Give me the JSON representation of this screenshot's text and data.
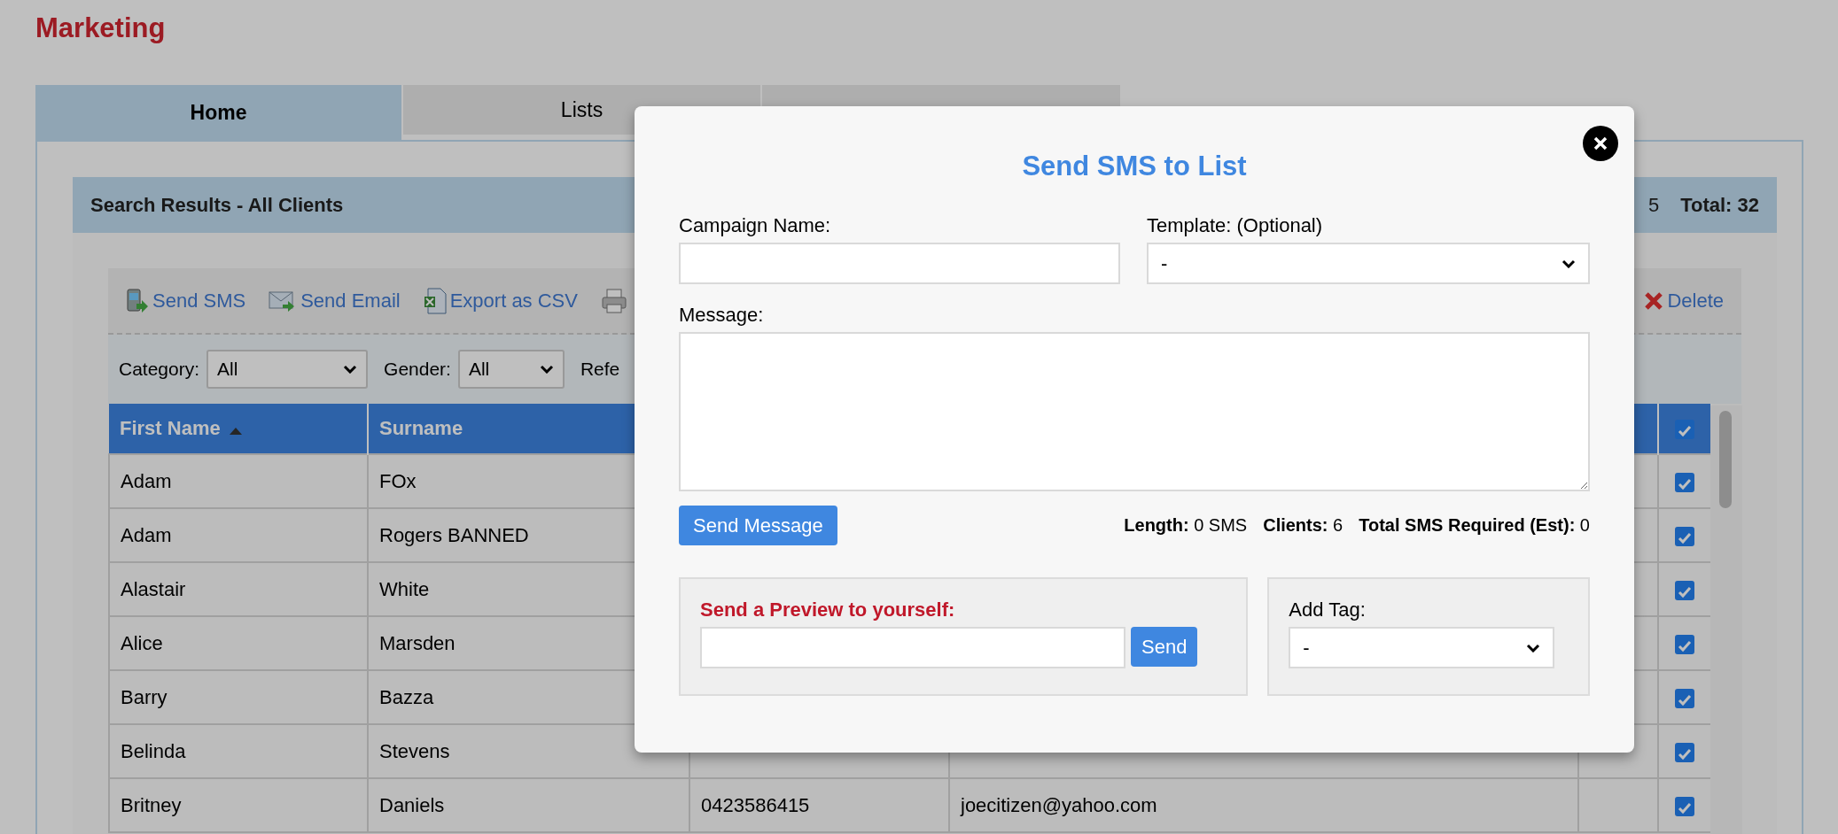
{
  "page_title": "Marketing",
  "tabs": [
    {
      "label": "Home",
      "selected": true
    },
    {
      "label": "Lists",
      "selected": false
    },
    {
      "selected": false
    }
  ],
  "results": {
    "title": "Search Results - All Clients",
    "count_tail": "5",
    "total": "Total: 32"
  },
  "toolbar": [
    {
      "kind": "sms",
      "label": "Send SMS"
    },
    {
      "kind": "email",
      "label": "Send Email"
    },
    {
      "kind": "csv",
      "label": "Export as CSV"
    },
    {
      "kind": "print"
    }
  ],
  "delete": "Delete",
  "filters": [
    {
      "label": "Category:",
      "value": "All"
    },
    {
      "label": "Gender:",
      "value": "All"
    }
  ],
  "filter_tail": "Refe",
  "table": {
    "columns": [
      {
        "label": "First Name",
        "sorted": true
      },
      {
        "label": "Surname",
        "sorted": false
      }
    ],
    "all_checked": true,
    "rows": [
      {
        "first": "Adam",
        "surname": "FOx",
        "checked": true
      },
      {
        "first": "Adam",
        "surname": "Rogers BANNED",
        "checked": true
      },
      {
        "first": "Alastair",
        "surname": "White",
        "checked": true
      },
      {
        "first": "Alice",
        "surname": "Marsden",
        "checked": true
      },
      {
        "first": "Barry",
        "surname": "Bazza",
        "checked": true
      },
      {
        "first": "Belinda",
        "surname": "Stevens",
        "checked": true
      },
      {
        "first": "Britney",
        "surname": "Daniels",
        "phone": "0423586415",
        "email": "joecitizen@yahoo.com",
        "checked": true
      }
    ]
  },
  "modal": {
    "title": "Send SMS to List",
    "campaign_label": "Campaign Name:",
    "template_label": "Template: (Optional)",
    "template_value": "-",
    "message_label": "Message:",
    "send_button": "Send Message",
    "stats": [
      "**Length:** 0 SMS",
      "**Clients:** 6",
      "**Total SMS Required (Est):** 0"
    ],
    "preview": {
      "label": "Send a Preview to yourself:",
      "button": "Send"
    },
    "tag": {
      "label": "Add Tag:",
      "value": "-"
    }
  }
}
